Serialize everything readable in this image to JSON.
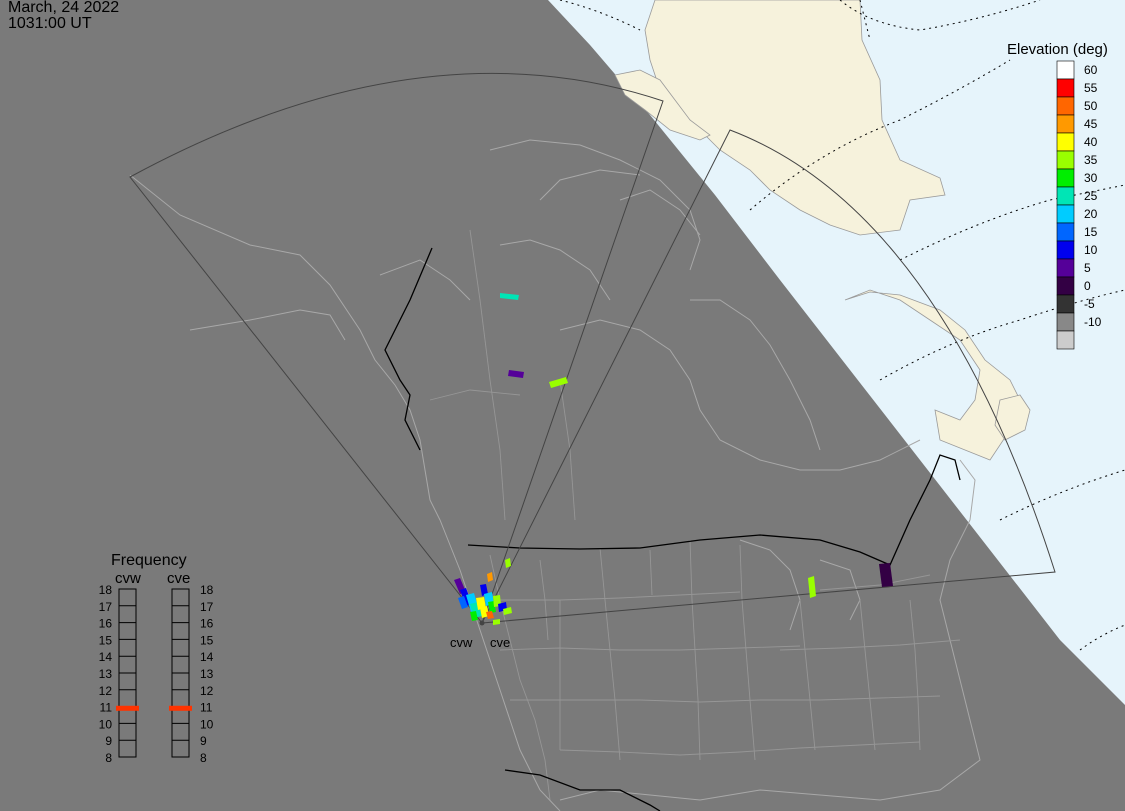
{
  "header": {
    "date": "March, 24 2022",
    "time": "1031:00 UT"
  },
  "colors": {
    "night": "#7a7a7a",
    "day_ocean": "#e6f4fb",
    "day_land": "#f6f2dc",
    "boundaries": "#a8a8a8",
    "borders": "#000000"
  },
  "radars": {
    "west": "cvw",
    "east": "cve"
  },
  "elevation_legend": {
    "title": "Elevation (deg)",
    "levels": [
      {
        "label": "60",
        "color": "#ffffff"
      },
      {
        "label": "55",
        "color": "#ff0000"
      },
      {
        "label": "50",
        "color": "#ff6600"
      },
      {
        "label": "45",
        "color": "#ff9900"
      },
      {
        "label": "40",
        "color": "#ffff00"
      },
      {
        "label": "35",
        "color": "#99ff00"
      },
      {
        "label": "30",
        "color": "#00ee00"
      },
      {
        "label": "25",
        "color": "#00e5b5"
      },
      {
        "label": "20",
        "color": "#00ccff"
      },
      {
        "label": "15",
        "color": "#0066ff"
      },
      {
        "label": "10",
        "color": "#0000ee"
      },
      {
        "label": "5",
        "color": "#550099"
      },
      {
        "label": "0",
        "color": "#330044"
      },
      {
        "label": "-5",
        "color": "#333333"
      },
      {
        "label": "-10",
        "color": "#888888"
      },
      {
        "label": "",
        "color": "#cccccc"
      }
    ]
  },
  "frequency": {
    "title": "Frequency",
    "scale": [
      "18",
      "17",
      "16",
      "15",
      "14",
      "13",
      "12",
      "11",
      "10",
      "9",
      "8"
    ],
    "indicator_color": "#ff3300",
    "radars": [
      {
        "name": "cvw",
        "frequency_mhz": 10.9
      },
      {
        "name": "cve",
        "frequency_mhz": 10.9
      }
    ]
  }
}
